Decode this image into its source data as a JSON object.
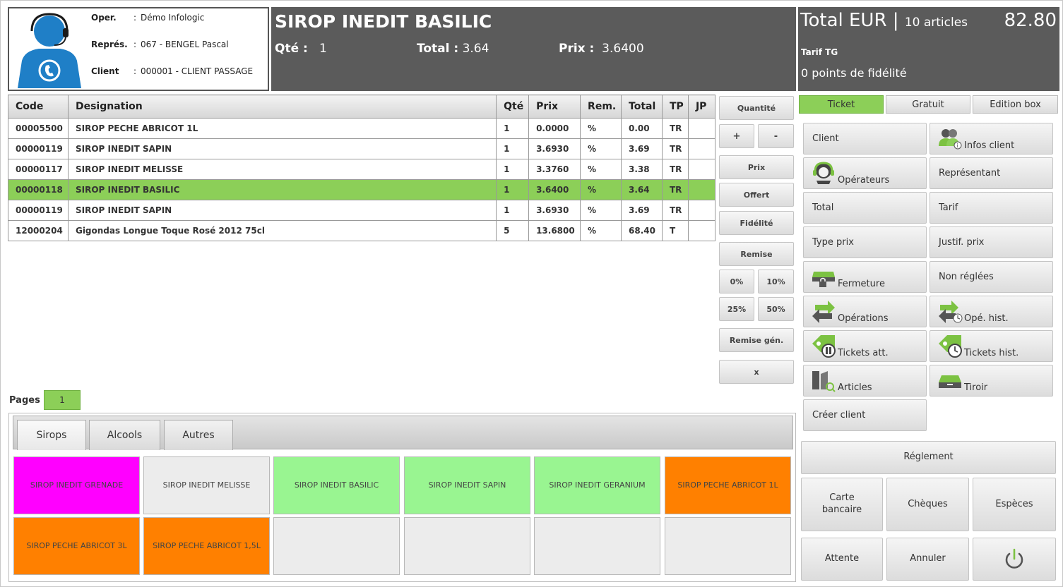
{
  "operator_panel": {
    "oper_label": "Oper.",
    "oper_value": "Démo Infologic",
    "repres_label": "Représ.",
    "repres_value": "067 - BENGEL Pascal",
    "client_label": "Client",
    "client_value": "000001 - CLIENT PASSAGE",
    "colon": ":"
  },
  "current_item": {
    "title": "SIROP INEDIT BASILIC",
    "qty_label": "Qté :",
    "qty_value": "1",
    "total_label": "Total :",
    "total_value": "3.64",
    "price_label": "Prix :",
    "price_value": "3.6400"
  },
  "totals": {
    "label": "Total EUR",
    "separator": "|",
    "articles": "10 articles",
    "amount": "82.80",
    "tarif": "Tarif TG",
    "fidelity": "0 points de fidélité"
  },
  "ticket": {
    "headers": [
      "Code",
      "Designation",
      "Qté",
      "Prix",
      "Rem.",
      "Total",
      "TP",
      "JP"
    ],
    "rows": [
      [
        "00005500",
        "SIROP PECHE ABRICOT 1L",
        "1",
        "0.0000",
        "%",
        "0.00",
        "TR",
        ""
      ],
      [
        "00000119",
        "SIROP INEDIT SAPIN",
        "1",
        "3.6930",
        "%",
        "3.69",
        "TR",
        ""
      ],
      [
        "00000117",
        "SIROP INEDIT MELISSE",
        "1",
        "3.3760",
        "%",
        "3.38",
        "TR",
        ""
      ],
      [
        "00000118",
        "SIROP INEDIT BASILIC",
        "1",
        "3.6400",
        "%",
        "3.64",
        "TR",
        ""
      ],
      [
        "00000119",
        "SIROP INEDIT SAPIN",
        "1",
        "3.6930",
        "%",
        "3.69",
        "TR",
        ""
      ],
      [
        "12000204",
        "Gigondas Longue Toque Rosé 2012 75cl",
        "5",
        "13.6800",
        "%",
        "68.40",
        "T",
        ""
      ]
    ],
    "selected_row": 3,
    "selected_color": "#8ccf58"
  },
  "actions": {
    "quantite": "Quantité",
    "plus": "+",
    "minus": "-",
    "prix": "Prix",
    "offert": "Offert",
    "fidelite": "Fidélité",
    "remise": "Remise",
    "r0": "0%",
    "r10": "10%",
    "r25": "25%",
    "r50": "50%",
    "remise_gen": "Remise gén.",
    "clear": "x"
  },
  "pages": {
    "label": "Pages :",
    "current": "1"
  },
  "product_tabs": [
    "Sirops",
    "Alcools",
    "Autres"
  ],
  "products": [
    {
      "label": "SIROP INEDIT GRENADE",
      "color": "#ff00ff"
    },
    {
      "label": "SIROP INEDIT MELISSE",
      "color": "#ececec"
    },
    {
      "label": "SIROP INEDIT BASILIC",
      "color": "#99f591"
    },
    {
      "label": "SIROP INEDIT SAPIN",
      "color": "#99f591"
    },
    {
      "label": "SIROP INEDIT GERANIUM",
      "color": "#99f591"
    },
    {
      "label": "SIROP PECHE ABRICOT 1L",
      "color": "#ff8000"
    },
    {
      "label": "SIROP PECHE ABRICOT 3L",
      "color": "#ff8000"
    },
    {
      "label": "SIROP PECHE ABRICOT 1,5L",
      "color": "#ff8000"
    },
    {
      "label": "",
      "color": "#ececec"
    },
    {
      "label": "",
      "color": "#ececec"
    },
    {
      "label": "",
      "color": "#ececec"
    },
    {
      "label": "",
      "color": "#ececec"
    }
  ],
  "right_tabs": [
    "Ticket",
    "Gratuit",
    "Edition box"
  ],
  "right_buttons": {
    "client": "Client",
    "infos_client": "Infos client",
    "operateurs": "Opérateurs",
    "representant": "Représentant",
    "total": "Total",
    "tarif": "Tarif",
    "type_prix": "Type prix",
    "justif_prix": "Justif. prix",
    "fermeture": "Fermeture",
    "non_reglees": "Non réglées",
    "operations": "Opérations",
    "ope_hist": "Opé. hist.",
    "tickets_att": "Tickets att.",
    "tickets_hist": "Tickets hist.",
    "articles": "Articles",
    "tiroir": "Tiroir",
    "creer_client": "Créer client"
  },
  "payment": {
    "reglement": "Réglement",
    "carte_line1": "Carte",
    "carte_line2": "bancaire",
    "cheques": "Chèques",
    "especes": "Espèces",
    "attente": "Attente",
    "annuler": "Annuler"
  },
  "colors": {
    "accent_green": "#8ccf58",
    "header_dark": "#5b5b5b",
    "icon_green": "#7cc242",
    "avatar_blue": "#1f7fc7"
  }
}
